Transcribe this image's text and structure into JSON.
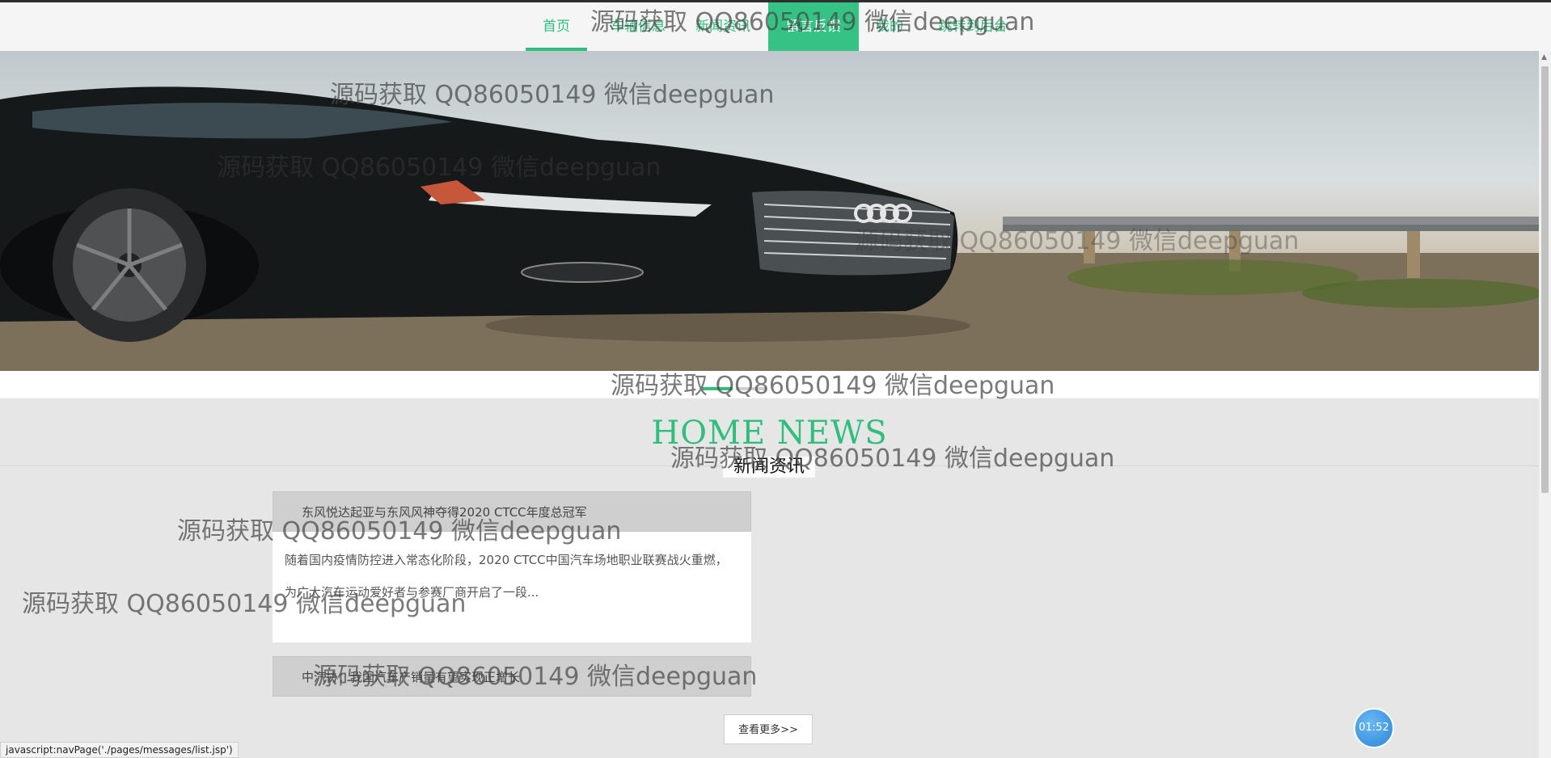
{
  "nav": {
    "items": [
      {
        "label": "首页"
      },
      {
        "label": "车辆信息"
      },
      {
        "label": "新闻资讯"
      },
      {
        "label": "留言反馈"
      },
      {
        "label": "我的"
      },
      {
        "label": "跳转到后台"
      }
    ]
  },
  "banner": {
    "brand": "Audi"
  },
  "section": {
    "title": "HOME NEWS",
    "subtitle": "新闻资讯"
  },
  "news": [
    {
      "title": "东风悦达起亚与东风风神夺得2020 CTCC年度总冠军",
      "summary": "随着国内疫情防控进入常态化阶段，2020 CTCC中国汽车场地职业联赛战火重燃，为广大汽车运动爱好者与参赛厂商开启了一段..."
    },
    {
      "title": "中汽协：我国汽车产销量有望实现正增长"
    }
  ],
  "more_button": "查看更多>>",
  "timer": "01:52",
  "status_url": "javascript:navPage('./pages/messages/list.jsp')",
  "watermark": "源码获取 QQ86050149 微信deepguan",
  "colors": {
    "accent": "#2fbf7c",
    "highlight": "#34c384",
    "timer": "#2b86d6"
  }
}
